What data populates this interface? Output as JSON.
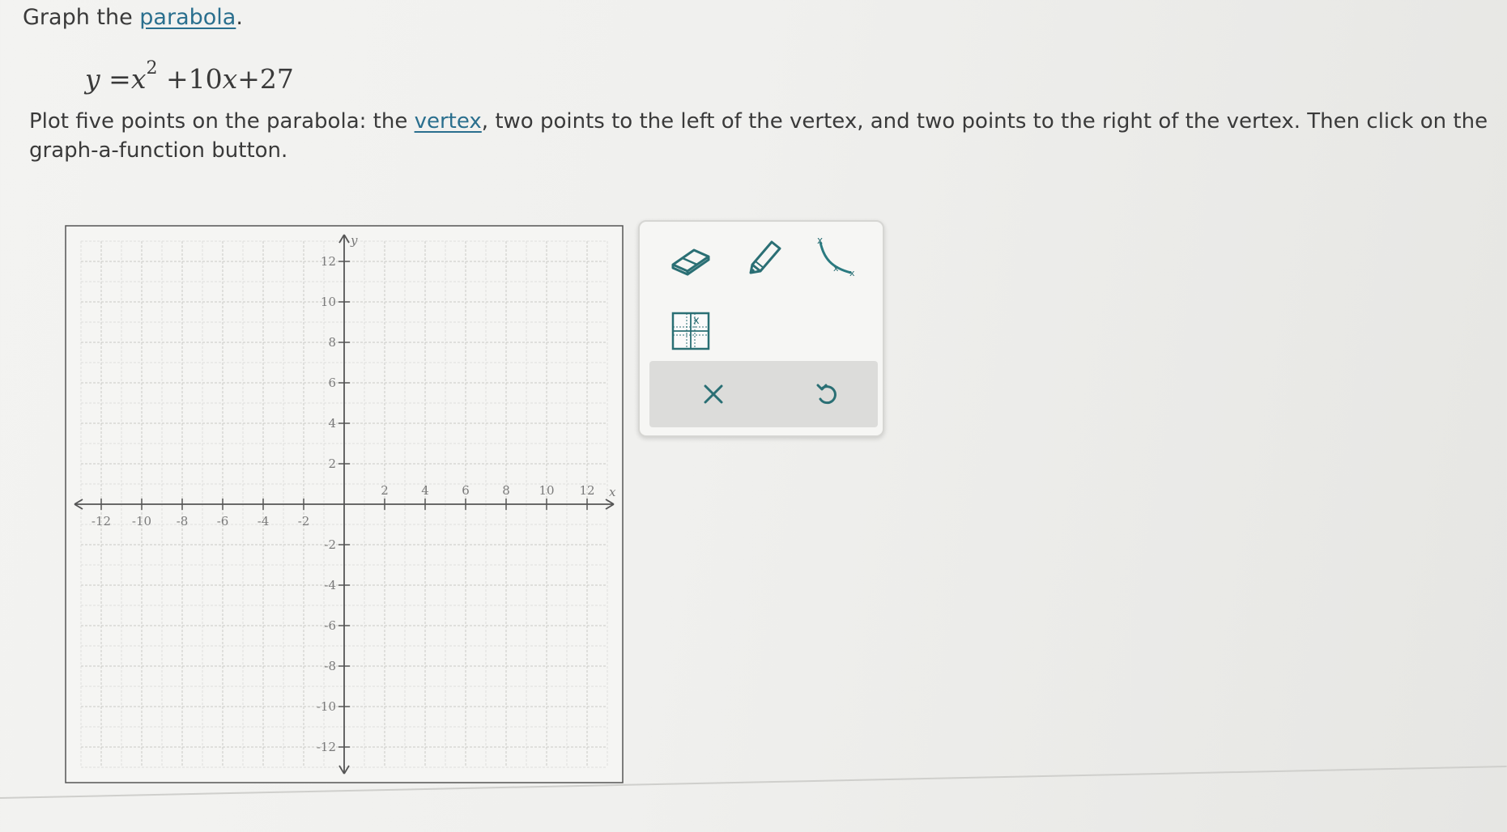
{
  "question": {
    "title_prefix": "Graph the ",
    "title_link": "parabola",
    "title_suffix": ".",
    "equation": {
      "lhs": "y",
      "equals": "=",
      "x": "x",
      "exponent": "2",
      "rest_a": "+10",
      "rest_x": "x",
      "rest_b": "+27"
    },
    "instruction_part1": "Plot five points on the parabola: the ",
    "instruction_link": "vertex",
    "instruction_part2": ", two points to the left of the vertex, and two points to the right of the vertex. Then click on the graph-a-function button."
  },
  "graph": {
    "x_axis_label": "x",
    "y_axis_label": "y",
    "xlim": [
      -13,
      13
    ],
    "ylim": [
      -13,
      13
    ],
    "x_tick_labels": [
      "-12",
      "-10",
      "-8",
      "-6",
      "-4",
      "-2",
      "2",
      "4",
      "6",
      "8",
      "10",
      "12"
    ],
    "y_tick_labels": [
      "12",
      "10",
      "8",
      "6",
      "4",
      "2",
      "-2",
      "-4",
      "-6",
      "-8",
      "-10",
      "-12"
    ],
    "x_tick_values": [
      -12,
      -10,
      -8,
      -6,
      -4,
      -2,
      2,
      4,
      6,
      8,
      10,
      12
    ],
    "y_tick_values": [
      12,
      10,
      8,
      6,
      4,
      2,
      -2,
      -4,
      -6,
      -8,
      -10,
      -12
    ],
    "grid": true
  },
  "toolbar": {
    "tools": [
      {
        "name": "eraser-tool",
        "icon": "eraser-icon"
      },
      {
        "name": "pencil-tool",
        "icon": "pencil-icon"
      },
      {
        "name": "graph-a-function-tool",
        "icon": "parabola-curve-icon"
      },
      {
        "name": "point-grid-tool",
        "icon": "grid-point-icon"
      }
    ],
    "actions": [
      {
        "name": "clear-button",
        "icon": "close-icon"
      },
      {
        "name": "undo-button",
        "icon": "undo-icon"
      }
    ],
    "accent_color": "#2a7a80"
  }
}
